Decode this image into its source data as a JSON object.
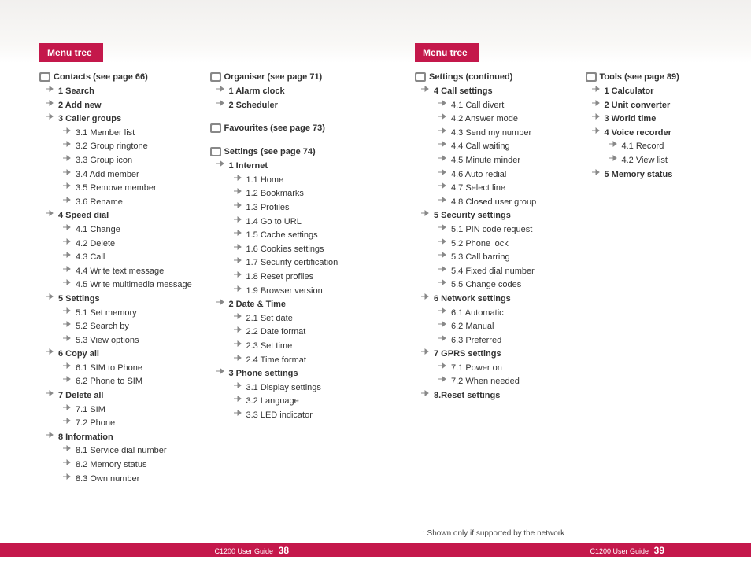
{
  "title_left": "Menu tree",
  "title_right": "Menu tree",
  "note_right": ": Shown only if supported by the network",
  "footer_label": "C1200 User Guide",
  "page_left": "38",
  "page_right": "39",
  "left_col1": [
    {
      "type": "section",
      "label": "Contacts (see page 66)"
    },
    {
      "type": "l1",
      "label": "1 Search"
    },
    {
      "type": "l1",
      "label": "2 Add new"
    },
    {
      "type": "l1",
      "label": "3 Caller groups"
    },
    {
      "type": "l2",
      "label": "3.1 Member list"
    },
    {
      "type": "l2",
      "label": "3.2 Group ringtone"
    },
    {
      "type": "l2",
      "label": "3.3 Group icon"
    },
    {
      "type": "l2",
      "label": "3.4 Add member"
    },
    {
      "type": "l2",
      "label": "3.5 Remove member"
    },
    {
      "type": "l2",
      "label": "3.6 Rename"
    },
    {
      "type": "l1",
      "label": "4 Speed dial"
    },
    {
      "type": "l2",
      "label": "4.1 Change"
    },
    {
      "type": "l2",
      "label": "4.2 Delete"
    },
    {
      "type": "l2",
      "label": "4.3 Call"
    },
    {
      "type": "l2",
      "label": "4.4 Write text message"
    },
    {
      "type": "l2",
      "label": "4.5 Write multimedia message"
    },
    {
      "type": "l1",
      "label": "5 Settings"
    },
    {
      "type": "l2",
      "label": "5.1 Set memory"
    },
    {
      "type": "l2",
      "label": "5.2 Search by"
    },
    {
      "type": "l2",
      "label": "5.3 View options"
    },
    {
      "type": "l1",
      "label": "6 Copy all"
    },
    {
      "type": "l2",
      "label": "6.1 SIM to Phone"
    },
    {
      "type": "l2",
      "label": "6.2 Phone to SIM"
    },
    {
      "type": "l1",
      "label": "7 Delete all"
    },
    {
      "type": "l2",
      "label": "7.1 SIM"
    },
    {
      "type": "l2",
      "label": "7.2 Phone"
    },
    {
      "type": "l1",
      "label": "8 Information"
    },
    {
      "type": "l2",
      "label": "8.1 Service dial number"
    },
    {
      "type": "l2",
      "label": "8.2 Memory status"
    },
    {
      "type": "l2",
      "label": "8.3 Own number"
    }
  ],
  "left_col2": [
    {
      "type": "section",
      "label": "Organiser (see page 71)"
    },
    {
      "type": "l1",
      "label": "1 Alarm clock"
    },
    {
      "type": "l1",
      "label": "2 Scheduler"
    },
    {
      "type": "gap"
    },
    {
      "type": "section",
      "label": "Favourites (see page 73)"
    },
    {
      "type": "gap"
    },
    {
      "type": "section",
      "label": "Settings (see page 74)"
    },
    {
      "type": "l1",
      "label": "1 Internet"
    },
    {
      "type": "l2",
      "label": "1.1 Home"
    },
    {
      "type": "l2",
      "label": "1.2 Bookmarks"
    },
    {
      "type": "l2",
      "label": "1.3 Profiles"
    },
    {
      "type": "l2",
      "label": "1.4 Go to URL"
    },
    {
      "type": "l2",
      "label": "1.5 Cache settings"
    },
    {
      "type": "l2",
      "label": "1.6 Cookies settings"
    },
    {
      "type": "l2",
      "label": "1.7 Security certification"
    },
    {
      "type": "l2",
      "label": "1.8 Reset profiles"
    },
    {
      "type": "l2",
      "label": "1.9 Browser version"
    },
    {
      "type": "l1",
      "label": "2 Date & Time"
    },
    {
      "type": "l2",
      "label": "2.1 Set date"
    },
    {
      "type": "l2",
      "label": "2.2 Date format"
    },
    {
      "type": "l2",
      "label": "2.3 Set time"
    },
    {
      "type": "l2",
      "label": "2.4 Time format"
    },
    {
      "type": "l1",
      "label": "3 Phone settings"
    },
    {
      "type": "l2",
      "label": "3.1 Display settings"
    },
    {
      "type": "l2",
      "label": "3.2 Language"
    },
    {
      "type": "l2",
      "label": "3.3 LED indicator"
    }
  ],
  "right_col1": [
    {
      "type": "section",
      "label": "Settings (continued)"
    },
    {
      "type": "l1",
      "label": "4 Call settings"
    },
    {
      "type": "l2",
      "label": "4.1 Call divert"
    },
    {
      "type": "l2",
      "label": "4.2 Answer mode"
    },
    {
      "type": "l2",
      "label": "4.3 Send my number"
    },
    {
      "type": "l2",
      "label": "4.4 Call waiting"
    },
    {
      "type": "l2",
      "label": "4.5 Minute minder"
    },
    {
      "type": "l2",
      "label": "4.6 Auto redial"
    },
    {
      "type": "l2",
      "label": "4.7 Select line"
    },
    {
      "type": "l2",
      "label": "4.8 Closed user group"
    },
    {
      "type": "l1",
      "label": "5 Security settings"
    },
    {
      "type": "l2",
      "label": "5.1 PIN code request"
    },
    {
      "type": "l2",
      "label": "5.2 Phone lock"
    },
    {
      "type": "l2",
      "label": "5.3 Call barring"
    },
    {
      "type": "l2",
      "label": "5.4 Fixed dial number"
    },
    {
      "type": "l2",
      "label": "5.5 Change codes"
    },
    {
      "type": "l1",
      "label": "6 Network settings"
    },
    {
      "type": "l2",
      "label": "6.1 Automatic"
    },
    {
      "type": "l2",
      "label": "6.2 Manual"
    },
    {
      "type": "l2",
      "label": "6.3 Preferred"
    },
    {
      "type": "l1",
      "label": "7 GPRS settings"
    },
    {
      "type": "l2",
      "label": "7.1 Power on"
    },
    {
      "type": "l2",
      "label": "7.2 When needed"
    },
    {
      "type": "l1",
      "label": "8.Reset settings"
    }
  ],
  "right_col2": [
    {
      "type": "section",
      "label": "Tools (see page 89)"
    },
    {
      "type": "l1",
      "label": "1 Calculator"
    },
    {
      "type": "l1",
      "label": "2 Unit converter"
    },
    {
      "type": "l1",
      "label": "3 World time"
    },
    {
      "type": "l1",
      "label": "4 Voice recorder"
    },
    {
      "type": "l2",
      "label": "4.1 Record"
    },
    {
      "type": "l2",
      "label": "4.2 View list"
    },
    {
      "type": "l1",
      "label": "5 Memory status"
    }
  ]
}
